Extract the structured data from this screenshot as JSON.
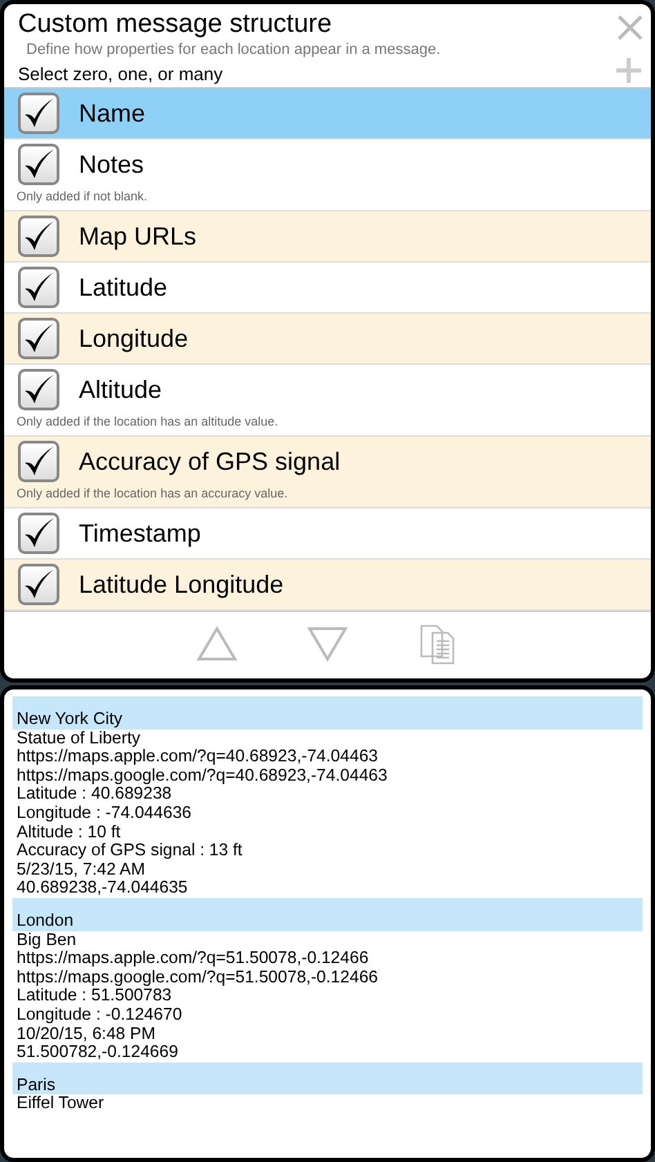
{
  "header": {
    "title": "Custom message structure",
    "subtitle": "Define how properties for each location appear in a message.",
    "instruction": "Select zero, one, or many"
  },
  "properties": [
    {
      "label": "Name",
      "checked": true,
      "selected": true
    },
    {
      "label": "Notes",
      "checked": true,
      "selected": false,
      "note": "Only added if not blank."
    },
    {
      "label": "Map URLs",
      "checked": true,
      "selected": false
    },
    {
      "label": "Latitude",
      "checked": true,
      "selected": false
    },
    {
      "label": "Longitude",
      "checked": true,
      "selected": false
    },
    {
      "label": "Altitude",
      "checked": true,
      "selected": false,
      "note": "Only added if the location has an altitude value."
    },
    {
      "label": "Accuracy of GPS signal",
      "checked": true,
      "selected": false,
      "note": "Only added if the location has an accuracy value."
    },
    {
      "label": "Timestamp",
      "checked": true,
      "selected": false
    },
    {
      "label": "Latitude Longitude",
      "checked": true,
      "selected": false
    }
  ],
  "preview": [
    {
      "name": "New York City",
      "lines": [
        "Statue of Liberty",
        "https://maps.apple.com/?q=40.68923,-74.04463",
        "https://maps.google.com/?q=40.68923,-74.04463",
        "Latitude : 40.689238",
        "Longitude : -74.044636",
        "Altitude : 10 ft",
        "Accuracy of GPS signal : 13 ft",
        "5/23/15, 7:42 AM",
        "40.689238,-74.044635"
      ]
    },
    {
      "name": "London",
      "lines": [
        "Big Ben",
        "https://maps.apple.com/?q=51.50078,-0.12466",
        "https://maps.google.com/?q=51.50078,-0.12466",
        "Latitude : 51.500783",
        "Longitude : -0.124670",
        "10/20/15, 6:48 PM",
        "51.500782,-0.124669"
      ]
    },
    {
      "name": "Paris",
      "lines": [
        "Eiffel Tower"
      ]
    }
  ]
}
